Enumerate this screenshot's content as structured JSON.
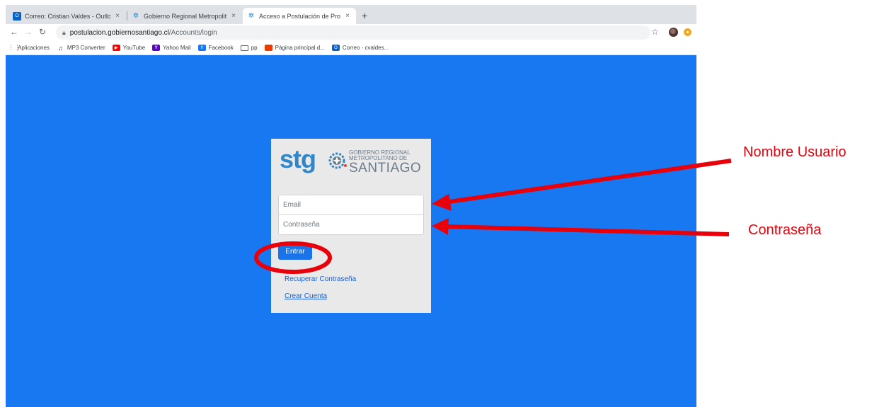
{
  "browser": {
    "tabs": [
      {
        "title": "Correo: Cristian Valdes - Outlo",
        "icon": "outlook-icon",
        "active": false
      },
      {
        "title": "Gobierno Regional Metropolita",
        "icon": "gore-icon",
        "active": false
      },
      {
        "title": "Acceso a Postulación de Proye",
        "icon": "gore-icon",
        "active": true
      }
    ],
    "tab_close": "×",
    "new_tab": "+",
    "url_host": "postulacion.gobiernosantiago.cl",
    "url_path": "/Accounts/login",
    "bookmarks": [
      {
        "label": "Aplicaciones",
        "icon": "apps-grid-icon"
      },
      {
        "label": "MP3 Converter",
        "icon": "music-note-icon"
      },
      {
        "label": "YouTube",
        "icon": "youtube-icon"
      },
      {
        "label": "Yahoo Mail",
        "icon": "yahoo-icon"
      },
      {
        "label": "Facebook",
        "icon": "facebook-icon"
      },
      {
        "label": "pp",
        "icon": "folder-icon"
      },
      {
        "label": "Página principal d...",
        "icon": "office-icon"
      },
      {
        "label": "Correo - cvaldes...",
        "icon": "outlook-icon"
      }
    ]
  },
  "page": {
    "background_color": "#1778f2",
    "logo": {
      "stg": "stg",
      "line1": "GOBIERNO REGIONAL",
      "line2": "METROPOLITANO DE",
      "line3": "SANTIAGO"
    },
    "email_placeholder": "Email",
    "password_placeholder": "Contraseña",
    "submit_label": "Entrar",
    "recover_link": "Recuperar Contraseña",
    "create_link": "Crear Cuenta"
  },
  "annotations": {
    "color": "#e8000b",
    "username_label": "Nombre Usuario",
    "password_label": "Contraseña"
  }
}
